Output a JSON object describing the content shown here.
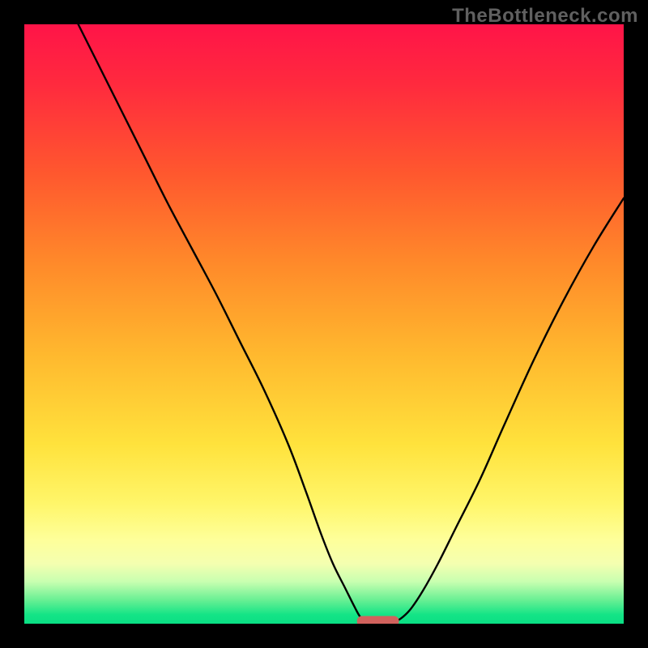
{
  "watermark": {
    "text": "TheBottleneck.com"
  },
  "colors": {
    "gradient_stops": [
      {
        "offset": 0.0,
        "color": "#ff1448"
      },
      {
        "offset": 0.1,
        "color": "#ff2a3e"
      },
      {
        "offset": 0.25,
        "color": "#ff582e"
      },
      {
        "offset": 0.4,
        "color": "#ff8a2a"
      },
      {
        "offset": 0.55,
        "color": "#ffb82e"
      },
      {
        "offset": 0.7,
        "color": "#ffe23c"
      },
      {
        "offset": 0.8,
        "color": "#fff66a"
      },
      {
        "offset": 0.86,
        "color": "#feff9a"
      },
      {
        "offset": 0.9,
        "color": "#f4ffb0"
      },
      {
        "offset": 0.93,
        "color": "#c8ffb0"
      },
      {
        "offset": 0.96,
        "color": "#6af094"
      },
      {
        "offset": 0.985,
        "color": "#14e486"
      },
      {
        "offset": 1.0,
        "color": "#0adf84"
      }
    ],
    "curve": "#000000",
    "marker": "#d1625d",
    "frame": "#000000"
  },
  "chart_data": {
    "type": "line",
    "title": "",
    "xlabel": "",
    "ylabel": "",
    "xlim": [
      0,
      100
    ],
    "ylim": [
      0,
      100
    ],
    "grid": false,
    "legend": false,
    "series": [
      {
        "name": "left-branch",
        "x": [
          9,
          12,
          16,
          20,
          24,
          28,
          32,
          36,
          40,
          44,
          47,
          49.5,
          51.5,
          53.5,
          55,
          56,
          57
        ],
        "y": [
          100,
          94,
          86,
          78,
          70,
          62.5,
          55,
          47,
          39,
          30,
          22,
          15,
          10,
          6,
          3,
          1.2,
          0.4
        ]
      },
      {
        "name": "right-branch",
        "x": [
          62,
          63,
          64.5,
          66.5,
          69,
          72,
          76,
          80,
          85,
          90,
          95,
          100
        ],
        "y": [
          0.4,
          1.0,
          2.5,
          5.5,
          10,
          16,
          24,
          33,
          44,
          54,
          63,
          71
        ]
      }
    ],
    "marker": {
      "x_start": 55.5,
      "x_end": 62.5,
      "y": 0.4
    }
  }
}
